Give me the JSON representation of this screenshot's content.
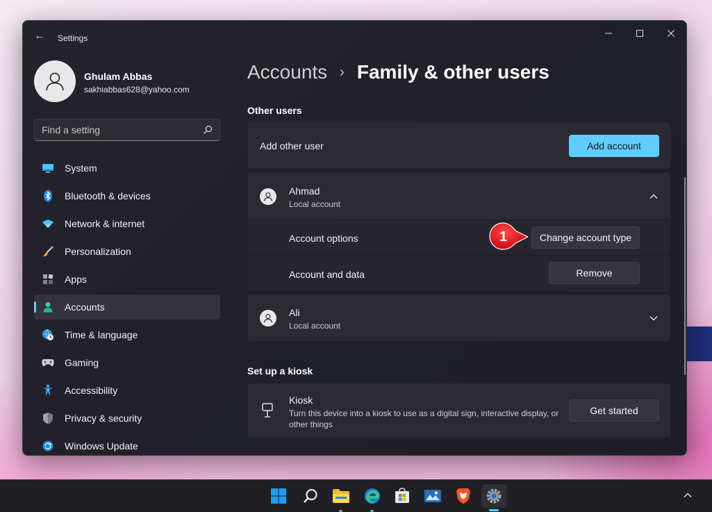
{
  "window": {
    "app_title": "Settings",
    "back_glyph": "←",
    "controls": {
      "minimize": "—",
      "maximize": "□",
      "close": "✕"
    }
  },
  "profile": {
    "name": "Ghulam Abbas",
    "email": "sakhiabbas628@yahoo.com",
    "avatar_icon": "person-icon"
  },
  "search": {
    "placeholder": "Find a setting",
    "icon": "search-icon"
  },
  "nav": {
    "items": [
      {
        "label": "System",
        "icon": "monitor-icon"
      },
      {
        "label": "Bluetooth & devices",
        "icon": "bluetooth-icon"
      },
      {
        "label": "Network & internet",
        "icon": "wifi-icon"
      },
      {
        "label": "Personalization",
        "icon": "brush-icon"
      },
      {
        "label": "Apps",
        "icon": "apps-icon"
      },
      {
        "label": "Accounts",
        "icon": "account-icon",
        "active": true
      },
      {
        "label": "Time & language",
        "icon": "globe-clock-icon"
      },
      {
        "label": "Gaming",
        "icon": "gamepad-icon"
      },
      {
        "label": "Accessibility",
        "icon": "accessibility-icon"
      },
      {
        "label": "Privacy & security",
        "icon": "shield-icon"
      },
      {
        "label": "Windows Update",
        "icon": "update-icon"
      }
    ]
  },
  "breadcrumb": {
    "parent": "Accounts",
    "separator": "›",
    "current": "Family & other users"
  },
  "other_users": {
    "section_title": "Other users",
    "add_row": {
      "label": "Add other user",
      "button": "Add account"
    },
    "users": [
      {
        "name": "Ahmad",
        "type": "Local account",
        "expanded": true,
        "options": [
          {
            "label": "Account options",
            "button": "Change account type"
          },
          {
            "label": "Account and data",
            "button": "Remove"
          }
        ]
      },
      {
        "name": "Ali",
        "type": "Local account",
        "expanded": false
      }
    ]
  },
  "kiosk": {
    "section_title": "Set up a kiosk",
    "title": "Kiosk",
    "description": "Turn this device into a kiosk to use as a digital sign, interactive display, or other things",
    "button": "Get started",
    "icon": "kiosk-icon"
  },
  "annotation": {
    "step_number": "1"
  },
  "taskbar": {
    "icons": [
      "start-icon",
      "search-icon",
      "file-explorer-icon",
      "edge-icon",
      "store-icon",
      "photos-icon",
      "brave-icon",
      "settings-icon"
    ],
    "active": "settings-icon"
  },
  "colors": {
    "accent": "#60cdff",
    "annotation_red": "#e0101a"
  }
}
